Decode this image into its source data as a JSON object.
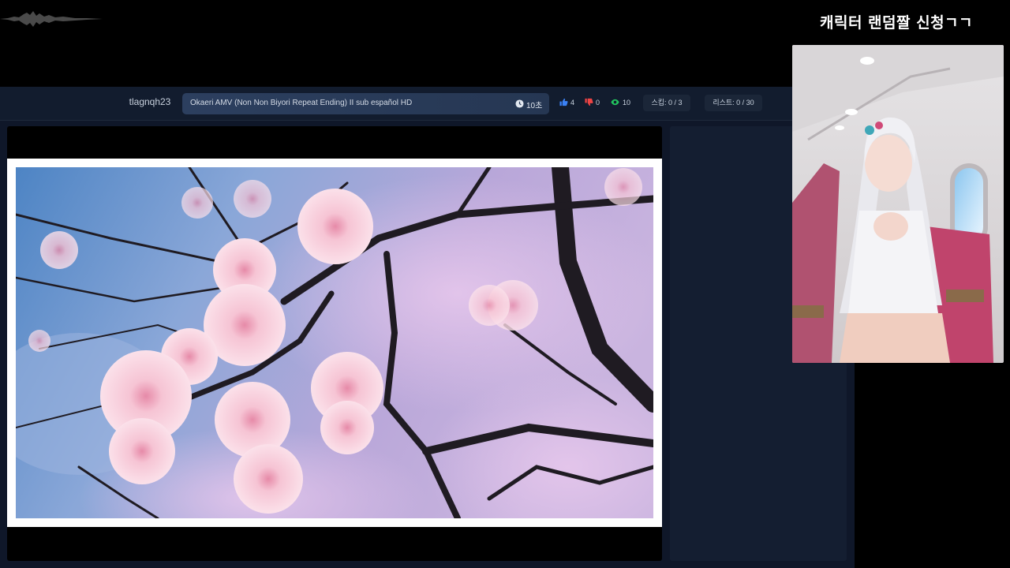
{
  "overlay": {
    "title": "캐릭터 랜덤짤 신청ㄱㄱ"
  },
  "info_bar": {
    "username": "tlagnqh23",
    "song_title": "Okaeri AMV (Non Non Biyori Repeat Ending) II sub español HD",
    "timer": "10초",
    "likes": "4",
    "dislikes": "0",
    "views": "10",
    "skip": "스킵: 0 / 3",
    "list": "리스트: 0 / 30"
  },
  "icons": {
    "timer": "clock-icon",
    "likes": "thumbs-up-icon",
    "dislikes": "thumbs-down-icon",
    "views": "eye-icon"
  },
  "colors": {
    "likes": "#3b82f6",
    "dislikes": "#ef4444",
    "views": "#22c55e",
    "bar_bg": "#121c2e",
    "field_bg": "#2c3f5f"
  }
}
